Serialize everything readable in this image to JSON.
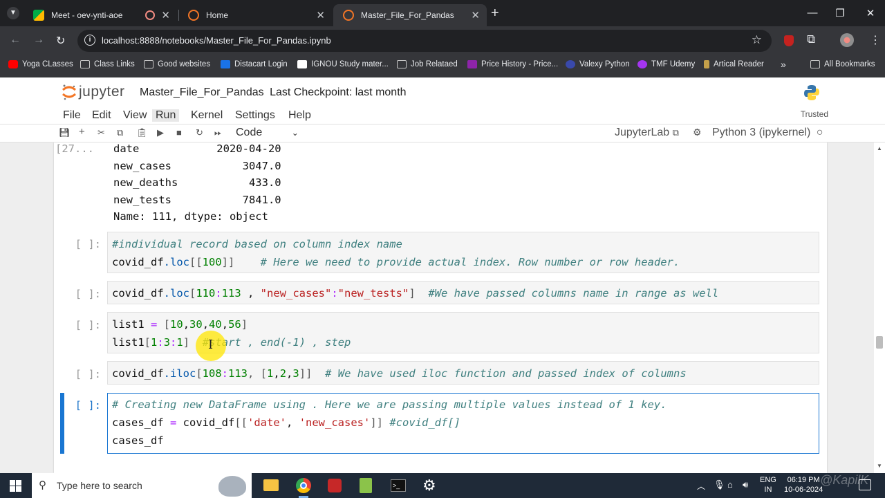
{
  "browser": {
    "tabs": [
      {
        "label": "Meet - oev-ynti-aoe",
        "active": false
      },
      {
        "label": "Home",
        "active": false
      },
      {
        "label": "Master_File_For_Pandas",
        "active": true
      }
    ],
    "new_tab": "+",
    "url": "localhost:8888/notebooks/Master_File_For_Pandas.ipynb",
    "bookmarks": [
      "Yoga CLasses",
      "Class Links",
      "Good websites",
      "Distacart Login",
      "IGNOU Study mater...",
      "Job Relataed",
      "Price History - Price...",
      "Valexy Python",
      "TMF Udemy",
      "Artical Reader"
    ],
    "all_bookmarks": "All Bookmarks"
  },
  "jupyter": {
    "logo": "jupyter",
    "notebook_name": "Master_File_For_Pandas",
    "checkpoint": "Last Checkpoint: last month",
    "menus": [
      "File",
      "Edit",
      "View",
      "Run",
      "Kernel",
      "Settings",
      "Help"
    ],
    "trusted": "Trusted",
    "cell_type": "Code",
    "jupyterlab_link": "JupyterLab",
    "kernel": "Python 3 (ipykernel)"
  },
  "output": {
    "prompt": "[27...",
    "lines": [
      "date            2020-04-20",
      "new_cases           3047.0",
      "new_deaths           433.0",
      "new_tests           7841.0",
      "Name: 111, dtype: object"
    ]
  },
  "cells": {
    "prompt": "[ ]:",
    "c1": {
      "l1": "#individual record based on column index name",
      "l2_a": "covid_df",
      "l2_b": ".loc",
      "l2_c": "[[",
      "l2_d": "100",
      "l2_e": "]]",
      "l2_f": "    # Here we need to provide actual index. Row number or row header."
    },
    "c2": {
      "a": "covid_df",
      "b": ".loc",
      "c": "[",
      "d": "110",
      "e": ":",
      "f": "113",
      "g": " , ",
      "h": "\"new_cases\"",
      "i": ":",
      "j": "\"new_tests\"",
      "k": "]",
      "l": "  #We have passed columns name in range as well"
    },
    "c3": {
      "l1_a": "list1 ",
      "l1_b": "=",
      "l1_c": " [",
      "l1_d": "10",
      "l1_e": ",",
      "l1_f": "30",
      "l1_g": ",",
      "l1_h": "40",
      "l1_i": ",",
      "l1_j": "56",
      "l1_k": "]",
      "l2_a": "list1",
      "l2_b": "[",
      "l2_c": "1",
      "l2_d": ":",
      "l2_e": "3",
      "l2_f": ":",
      "l2_g": "1",
      "l2_h": "]",
      "l2_i": "  #start , end(-1) , step"
    },
    "c4": {
      "a": "covid_df",
      "b": ".iloc",
      "c": "[",
      "d": "108",
      "e": ":",
      "f": "113",
      "g": ", [",
      "h": "1",
      "i": ",",
      "j": "2",
      "k": ",",
      "l": "3",
      "m": "]]",
      "n": "  # We have used iloc function and passed index of columns"
    },
    "c5": {
      "l1": "# Creating new DataFrame using . Here we are passing multiple values instead of 1 key.",
      "l2_a": "cases_df ",
      "l2_b": "=",
      "l2_c": " covid_df",
      "l2_d": "[[",
      "l2_e": "'date'",
      "l2_f": ", ",
      "l2_g": "'new_cases'",
      "l2_h": "]]",
      "l2_i": " #covid_df[]",
      "l3": "cases_df"
    }
  },
  "taskbar": {
    "search_placeholder": "Type here to search",
    "lang1": "ENG",
    "lang2": "IN",
    "time": "06:19 PM",
    "date": "10-06-2024"
  },
  "watermark": "@KapilK",
  "colors": {
    "chrome_dark": "#202124",
    "chrome_mid": "#35363a",
    "jupyter_orange": "#f37626",
    "active_blue": "#1976d2",
    "taskbar": "#1f2a38"
  }
}
